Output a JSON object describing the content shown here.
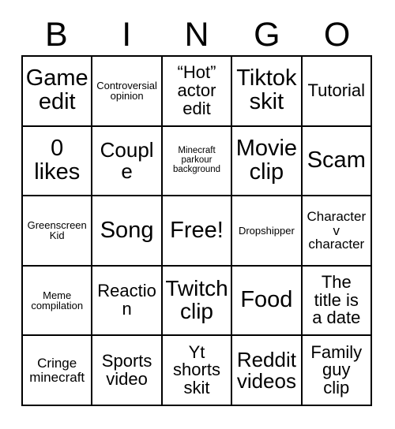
{
  "card": {
    "title": "BINGO",
    "header_letters": [
      "B",
      "I",
      "N",
      "G",
      "O"
    ],
    "free_space_label": "Free!",
    "text_color": "#000000",
    "border_color": "#000000",
    "background_color": "#ffffff",
    "columns": 5,
    "rows": 5
  },
  "cells": [
    {
      "id": "b1",
      "column": "B",
      "row": 1,
      "text": "Game\nedit",
      "size": "sz-xl",
      "free": false
    },
    {
      "id": "i1",
      "column": "I",
      "row": 1,
      "text": "Controversial\nopinion",
      "size": "sz-xs",
      "free": false
    },
    {
      "id": "n1",
      "column": "N",
      "row": 1,
      "text": "“Hot”\nactor\nedit",
      "size": "sz-md",
      "free": false
    },
    {
      "id": "g1",
      "column": "G",
      "row": 1,
      "text": "Tiktok\nskit",
      "size": "sz-xl",
      "free": false
    },
    {
      "id": "o1",
      "column": "O",
      "row": 1,
      "text": "Tutorial",
      "size": "sz-md",
      "free": false
    },
    {
      "id": "b2",
      "column": "B",
      "row": 2,
      "text": "0\nlikes",
      "size": "sz-xl",
      "free": false
    },
    {
      "id": "i2",
      "column": "I",
      "row": 2,
      "text": "Couple",
      "size": "sz-lg",
      "free": false
    },
    {
      "id": "n2",
      "column": "N",
      "row": 2,
      "text": "Minecraft\nparkour\nbackground",
      "size": "sz-xxs",
      "free": false
    },
    {
      "id": "g2",
      "column": "G",
      "row": 2,
      "text": "Movie\nclip",
      "size": "sz-xl",
      "free": false
    },
    {
      "id": "o2",
      "column": "O",
      "row": 2,
      "text": "Scam",
      "size": "sz-xl",
      "free": false
    },
    {
      "id": "b3",
      "column": "B",
      "row": 3,
      "text": "Greenscreen\nKid",
      "size": "sz-xs",
      "free": false
    },
    {
      "id": "i3",
      "column": "I",
      "row": 3,
      "text": "Song",
      "size": "sz-xl",
      "free": false
    },
    {
      "id": "n3",
      "column": "N",
      "row": 3,
      "text": "Free!",
      "size": "sz-xl",
      "free": true
    },
    {
      "id": "g3",
      "column": "G",
      "row": 3,
      "text": "Dropshipper",
      "size": "sz-xs",
      "free": false
    },
    {
      "id": "o3",
      "column": "O",
      "row": 3,
      "text": "Character\nv\ncharacter",
      "size": "sz-sm",
      "free": false
    },
    {
      "id": "b4",
      "column": "B",
      "row": 4,
      "text": "Meme\ncompilation",
      "size": "sz-xs",
      "free": false
    },
    {
      "id": "i4",
      "column": "I",
      "row": 4,
      "text": "Reaction",
      "size": "sz-md",
      "free": false
    },
    {
      "id": "n4",
      "column": "N",
      "row": 4,
      "text": "Twitch\nclip",
      "size": "sz-xl",
      "free": false
    },
    {
      "id": "g4",
      "column": "G",
      "row": 4,
      "text": "Food",
      "size": "sz-xl",
      "free": false
    },
    {
      "id": "o4",
      "column": "O",
      "row": 4,
      "text": "The\ntitle is\na date",
      "size": "sz-md",
      "free": false
    },
    {
      "id": "b5",
      "column": "B",
      "row": 5,
      "text": "Cringe\nminecraft",
      "size": "sz-sm",
      "free": false
    },
    {
      "id": "i5",
      "column": "I",
      "row": 5,
      "text": "Sports\nvideo",
      "size": "sz-md",
      "free": false
    },
    {
      "id": "n5",
      "column": "N",
      "row": 5,
      "text": "Yt\nshorts\nskit",
      "size": "sz-md",
      "free": false
    },
    {
      "id": "g5",
      "column": "G",
      "row": 5,
      "text": "Reddit\nvideos",
      "size": "sz-lg",
      "free": false
    },
    {
      "id": "o5",
      "column": "O",
      "row": 5,
      "text": "Family\nguy\nclip",
      "size": "sz-md",
      "free": false
    }
  ]
}
